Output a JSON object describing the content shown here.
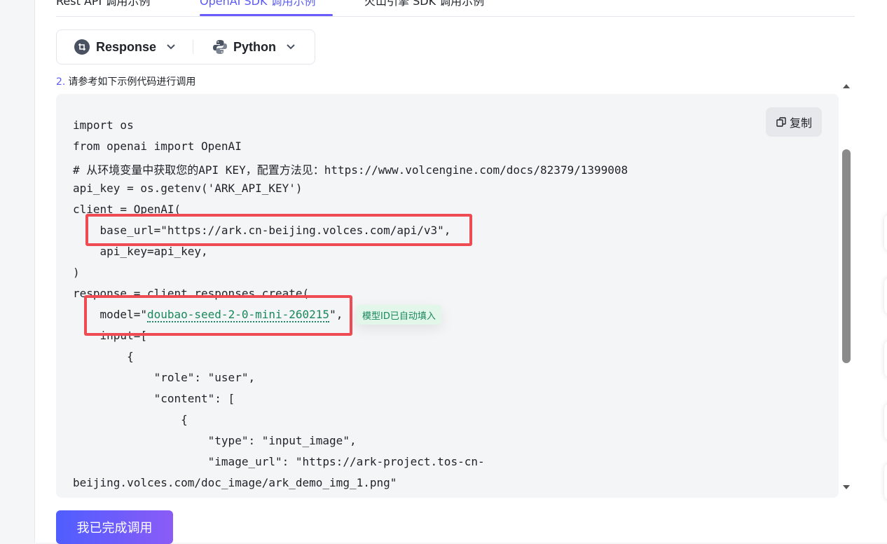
{
  "tabs": {
    "items": [
      {
        "label": "Rest API 调用示例"
      },
      {
        "label": "OpenAI SDK 调用示例"
      },
      {
        "label": "火山引擎 SDK 调用示例"
      }
    ],
    "active_index": 1
  },
  "selector": {
    "api_label": "Response",
    "lang_label": "Python"
  },
  "step": {
    "number": "2.",
    "text": "请参考如下示例代码进行调用"
  },
  "code": {
    "copy_label": "复制",
    "lines": [
      "import os",
      "from openai import OpenAI",
      "# 从环境变量中获取您的API KEY，配置方法见：https://www.volcengine.com/docs/82379/1399008",
      "api_key = os.getenv('ARK_API_KEY')",
      "client = OpenAI(",
      "    base_url=\"https://ark.cn-beijing.volces.com/api/v3\",",
      "    api_key=api_key,",
      ")",
      "response = client.responses.create(",
      "    model=\"",
      "    input=[",
      "        {",
      "            \"role\": \"user\",",
      "            \"content\": [",
      "                {",
      "                    \"type\": \"input_image\",",
      "                    \"image_url\": \"https://ark-project.tos-cn-",
      "beijing.volces.com/doc_image/ark_demo_img_1.png\""
    ],
    "model_value": "doubao-seed-2-0-mini-260215",
    "model_suffix": "\",",
    "auto_fill_tag": "模型ID已自动填入"
  },
  "done_button": "我已完成调用",
  "colors": {
    "accent": "#5b5bf6",
    "highlight": "#ef4b52",
    "model_green": "#19885c"
  }
}
